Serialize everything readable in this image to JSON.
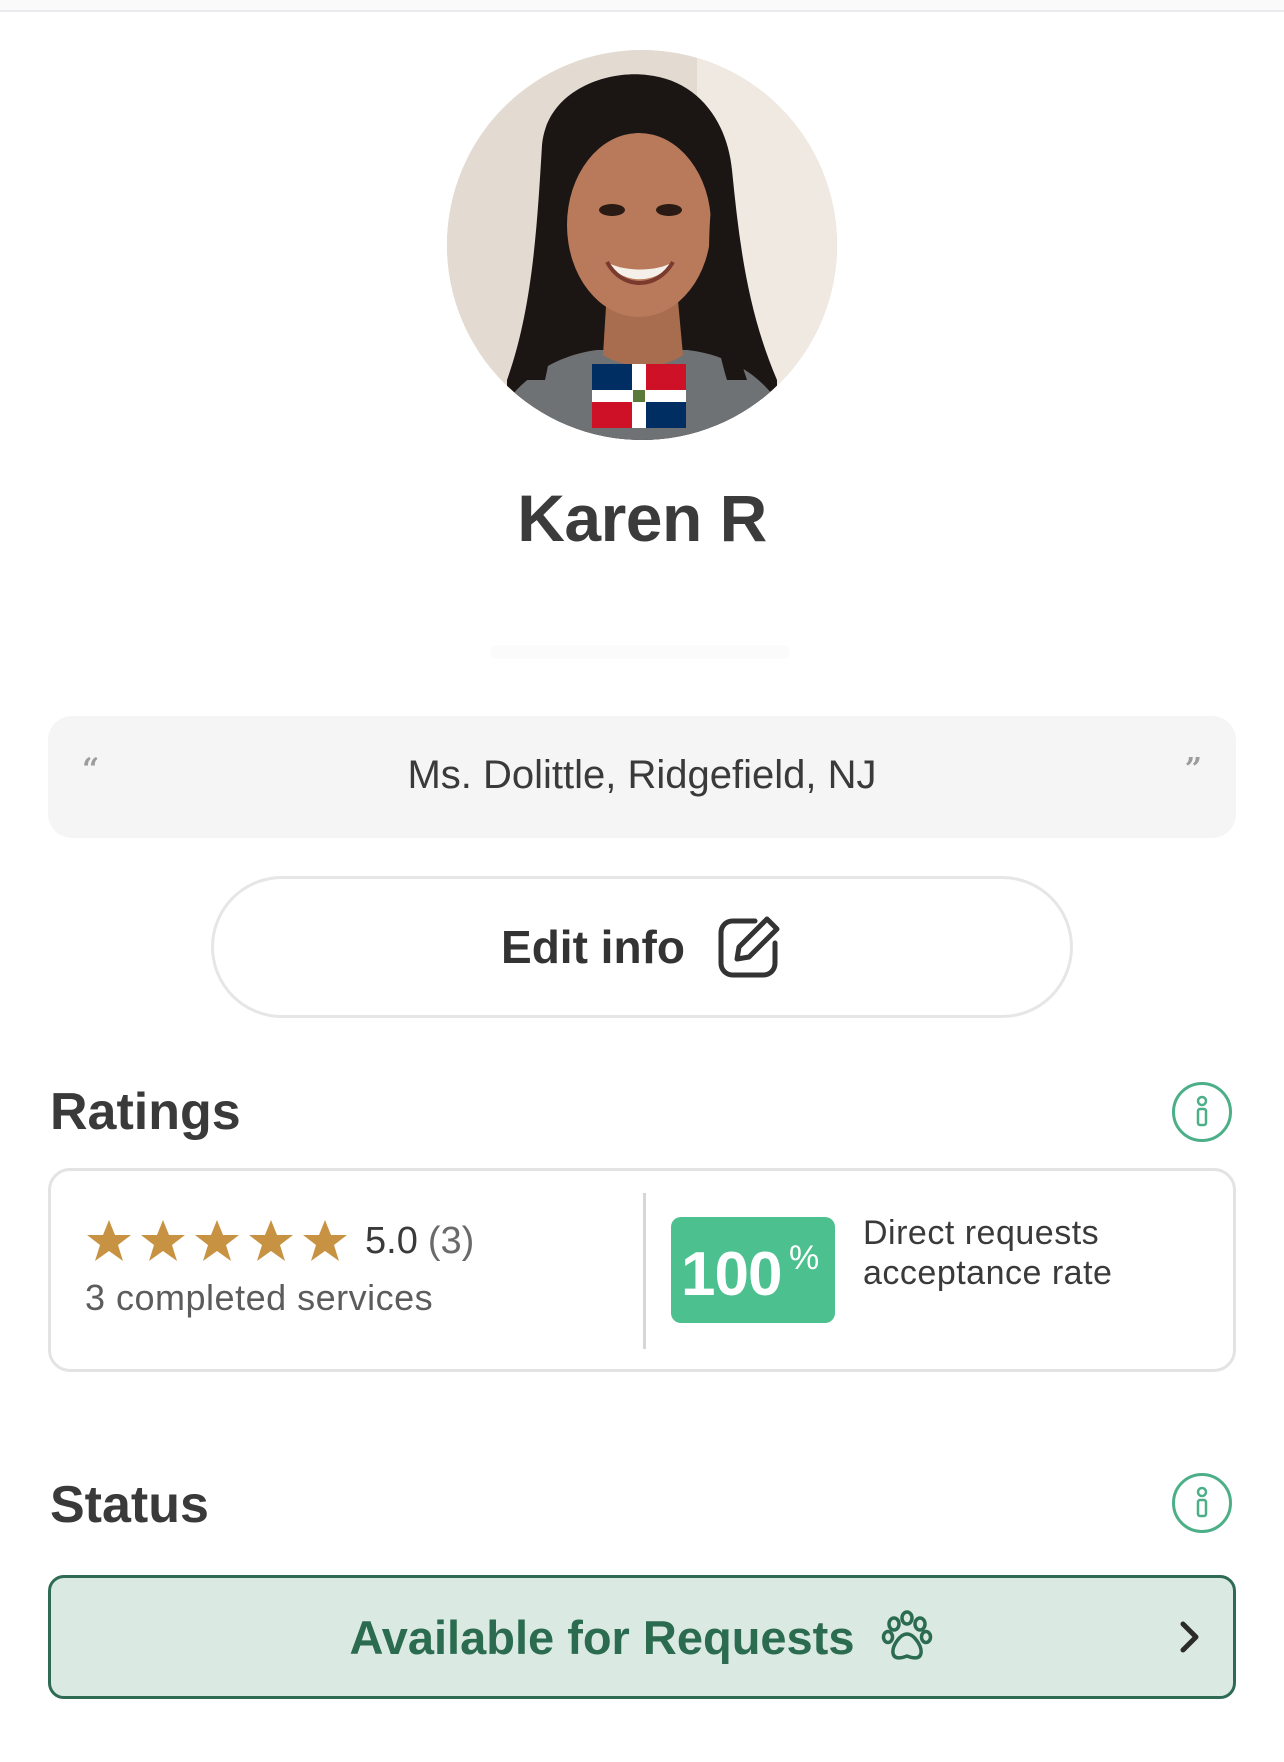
{
  "profile": {
    "name": "Karen R",
    "quote": "Ms. Dolittle, Ridgefield, NJ",
    "quote_open": "“",
    "quote_close": "”"
  },
  "edit": {
    "label": "Edit info"
  },
  "ratings": {
    "title": "Ratings",
    "stars": 5,
    "score": "5.0",
    "count": "(3)",
    "completed": "3 completed services",
    "acceptance_value": "100",
    "acceptance_unit": "%",
    "acceptance_label": "Direct requests acceptance rate"
  },
  "status": {
    "title": "Status",
    "value": "Available for Requests"
  },
  "colors": {
    "accent_green": "#4cc08e",
    "status_green": "#2b6b4f",
    "star_gold": "#c79343"
  },
  "icons": {
    "edit": "edit-pencil-icon",
    "info": "info-icon",
    "paw": "paw-icon",
    "chevron": "chevron-right-icon",
    "flag": "dominican-republic-flag-icon"
  }
}
